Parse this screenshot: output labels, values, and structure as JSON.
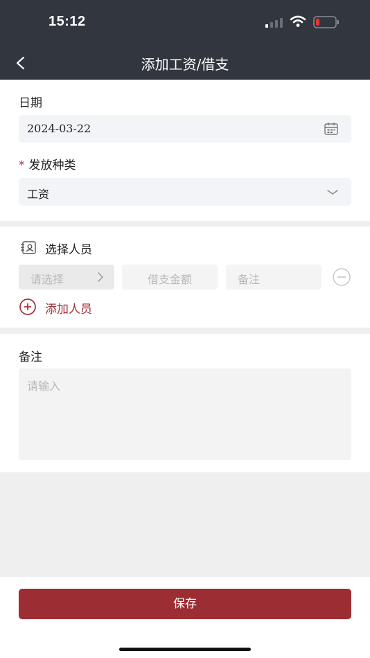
{
  "status_bar": {
    "time": "15:12"
  },
  "nav": {
    "title": "添加工资/借支",
    "back_icon": "chevron-left-icon"
  },
  "form": {
    "date": {
      "label": "日期",
      "value": "2024-03-22",
      "icon": "calendar-icon"
    },
    "payout_type": {
      "required_mark": "*",
      "label": "发放种类",
      "value": "工资",
      "icon": "chevron-down-icon"
    }
  },
  "personnel": {
    "title": "选择人员",
    "icon": "contact-card-icon",
    "row": {
      "select_placeholder": "请选择",
      "amount_placeholder": "借支金额",
      "note_placeholder": "备注",
      "remove_icon": "minus-circle-icon"
    },
    "add_label": "添加人员",
    "add_icon": "plus-circle-icon"
  },
  "remarks": {
    "label": "备注",
    "placeholder": "请输入"
  },
  "footer": {
    "save_label": "保存"
  },
  "colors": {
    "header_bg": "#32363e",
    "accent": "#9b2d33",
    "field_bg": "#f3f4f7",
    "page_bg": "#efefef"
  }
}
